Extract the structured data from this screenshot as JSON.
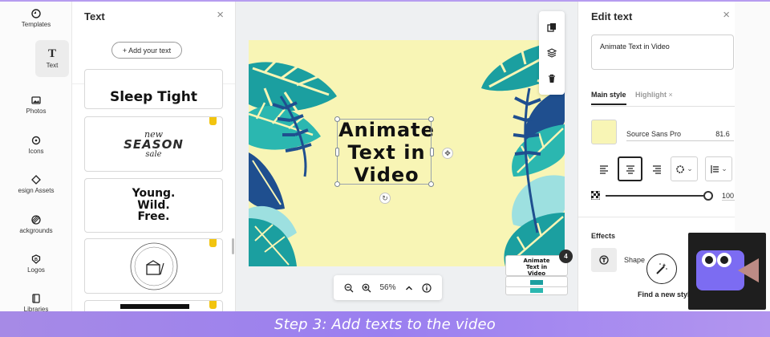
{
  "rail": {
    "items": [
      {
        "label": "Templates",
        "icon": "templates-icon"
      },
      {
        "label": "Text",
        "icon": "text-icon"
      },
      {
        "label": "Photos",
        "icon": "photos-icon"
      },
      {
        "label": "Icons",
        "icon": "icons-icon"
      },
      {
        "label": "esign Assets",
        "icon": "design-assets-icon"
      },
      {
        "label": "ackgrounds",
        "icon": "backgrounds-icon"
      },
      {
        "label": "Logos",
        "icon": "logos-icon"
      },
      {
        "label": "Libraries",
        "icon": "libraries-icon"
      }
    ]
  },
  "text_panel": {
    "title": "Text",
    "add_button": "+ Add your text",
    "cards": [
      {
        "text": "Sleep Tight"
      },
      {
        "line1": "new",
        "line2": "SEASON",
        "line3": "sale"
      },
      {
        "line1": "Young.",
        "line2": "Wild.",
        "line3": "Free."
      },
      {
        "text": "cleaning service logo"
      },
      {
        "text": "dark banner"
      }
    ]
  },
  "canvas": {
    "text_lines": [
      "Animate",
      "Text in",
      "Video"
    ],
    "background_color": "#f8f5b5",
    "leaf_colors": [
      "#1b9fa0",
      "#1f4f8f",
      "#2bb7b0",
      "#9de0e0"
    ]
  },
  "zoom": {
    "level": "56%"
  },
  "pages": {
    "count": "4",
    "thumb_lines": [
      "Animate",
      "Text in",
      "Video"
    ]
  },
  "edit_panel": {
    "title": "Edit text",
    "text_value": "Animate Text in Video",
    "tab_main": "Main style",
    "tab_highlight": "Highlight",
    "font_name": "Source Sans Pro",
    "font_size": "81.6",
    "opacity_value": "100",
    "opacity_level": 1.0,
    "effects_title": "Effects",
    "shape_label": "Shape",
    "find_style_label": "Find a new style",
    "swatch_color": "#f8f5b5"
  },
  "caption": {
    "text": "Step 3: Add texts to the video"
  }
}
